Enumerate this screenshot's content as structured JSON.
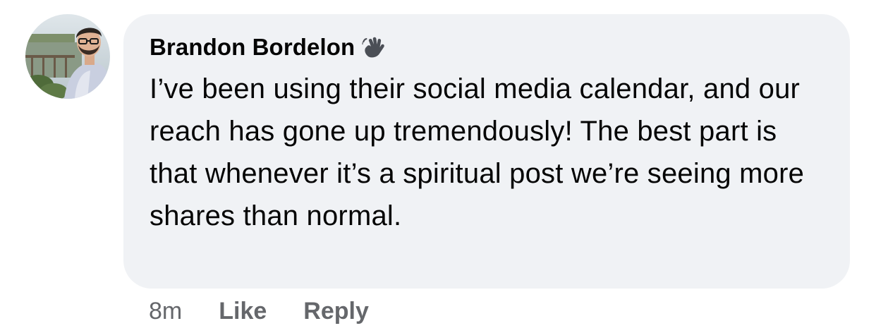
{
  "comment": {
    "author": "Brandon Bordelon",
    "badge_icon": "waving-hand-icon",
    "avatar": "profile-photo",
    "text": "I’ve been using their social media calendar, and our reach has gone up tremendously! The best part is that whenever it’s a spiritual post we’re seeing more shares than normal.",
    "timestamp": "8m",
    "actions": {
      "like_label": "Like",
      "reply_label": "Reply"
    }
  },
  "colors": {
    "bubble_background": "#f0f2f5",
    "primary_text": "#050505",
    "secondary_text": "#65676b"
  }
}
